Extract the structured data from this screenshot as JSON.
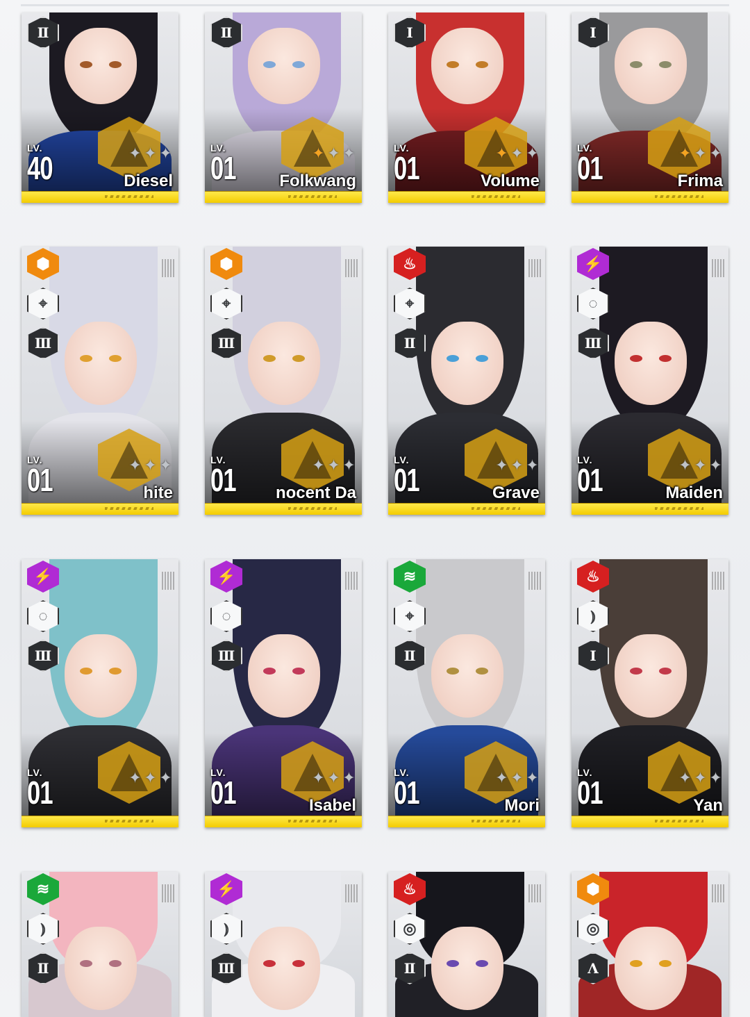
{
  "colors": {
    "level_bar": "#f3cc00",
    "emblem": "#d6a014",
    "star_on": "#f4a321",
    "star_off": "#bfc3c8",
    "element_iron": "#f08a0e",
    "element_electric": "#b02bd4",
    "element_fire": "#d62020",
    "element_wind": "#1aa83a",
    "element_water": "#2b7fd6"
  },
  "characters": [
    {
      "name": "Diesel",
      "lv_label": "LV.",
      "level": "40",
      "tier": "Ⅱ",
      "stars": [
        false,
        false,
        false
      ],
      "element": "",
      "weapon": ""
    },
    {
      "name": "Folkwang",
      "lv_label": "LV.",
      "level": "01",
      "tier": "Ⅱ",
      "stars": [
        true,
        false,
        false
      ],
      "element": "",
      "weapon": ""
    },
    {
      "name": "Volume",
      "lv_label": "LV.",
      "level": "01",
      "tier": "Ⅰ",
      "stars": [
        true,
        false,
        false
      ],
      "element": "",
      "weapon": ""
    },
    {
      "name": "Frima",
      "lv_label": "LV.",
      "level": "01",
      "tier": "Ⅰ",
      "stars": [
        true,
        false,
        false
      ],
      "element": "",
      "weapon": ""
    },
    {
      "name": "hite",
      "lv_label": "LV.",
      "level": "01",
      "tier": "Ⅲ",
      "stars": [
        false,
        false,
        false
      ],
      "element": "iron-icon",
      "weapon": "crosshair-icon"
    },
    {
      "name": "nocent Da",
      "lv_label": "LV.",
      "level": "01",
      "tier": "Ⅲ",
      "stars": [
        false,
        false,
        false
      ],
      "element": "iron-icon",
      "weapon": "crosshair-icon"
    },
    {
      "name": "Grave",
      "lv_label": "LV.",
      "level": "01",
      "tier": "Ⅱ",
      "stars": [
        false,
        false,
        false
      ],
      "element": "fire-icon",
      "weapon": "crosshair-icon"
    },
    {
      "name": "Maiden",
      "lv_label": "LV.",
      "level": "01",
      "tier": "Ⅲ",
      "stars": [
        false,
        false,
        false
      ],
      "element": "electric-icon",
      "weapon": "dotted-circle-icon"
    },
    {
      "name": "",
      "lv_label": "LV.",
      "level": "01",
      "tier": "Ⅲ",
      "stars": [
        false,
        false,
        false
      ],
      "element": "electric-icon",
      "weapon": "dotted-circle-icon"
    },
    {
      "name": "Isabel",
      "lv_label": "LV.",
      "level": "01",
      "tier": "Ⅲ",
      "stars": [
        false,
        false,
        false
      ],
      "element": "electric-icon",
      "weapon": "dotted-circle-icon"
    },
    {
      "name": "Mori",
      "lv_label": "LV.",
      "level": "01",
      "tier": "Ⅱ",
      "stars": [
        false,
        false,
        false
      ],
      "element": "wind-icon",
      "weapon": "crosshair-icon"
    },
    {
      "name": "Yan",
      "lv_label": "LV.",
      "level": "01",
      "tier": "Ⅰ",
      "stars": [
        false,
        false,
        false
      ],
      "element": "fire-icon",
      "weapon": "brackets-icon"
    },
    {
      "name": "",
      "lv_label": "",
      "level": "",
      "tier": "Ⅱ",
      "stars": [],
      "element": "wind-icon",
      "weapon": "brackets-icon"
    },
    {
      "name": "",
      "lv_label": "",
      "level": "",
      "tier": "Ⅲ",
      "stars": [],
      "element": "electric-icon",
      "weapon": "brackets-icon"
    },
    {
      "name": "",
      "lv_label": "",
      "level": "",
      "tier": "Ⅱ",
      "stars": [],
      "element": "fire-icon",
      "weapon": "scope-icon"
    },
    {
      "name": "",
      "lv_label": "",
      "level": "",
      "tier": "",
      "stars": [],
      "element": "iron-icon",
      "weapon": "scope-icon"
    }
  ]
}
